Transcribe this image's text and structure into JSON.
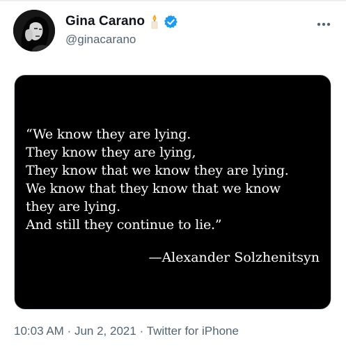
{
  "author": {
    "display_name": "Gina Carano",
    "handle": "@ginacarano",
    "avatar_icon": "profile-photo",
    "status_emoji": "candle-icon",
    "verified_badge": "verified-check-icon"
  },
  "more_menu_icon": "ellipsis-icon",
  "media": {
    "background": "#000000",
    "quote_lines": [
      "“We know they are lying.",
      "They know they are lying,",
      "They know that we know they are lying.",
      "We know that they know that we know",
      "they are lying.",
      "And still they continue to lie.”"
    ],
    "attribution": "—Alexander Solzhenitsyn"
  },
  "meta": {
    "time": "10:03 AM",
    "separator": "·",
    "date": "Jun 2, 2021",
    "source": "Twitter for iPhone"
  },
  "colors": {
    "text_primary": "#0f1419",
    "text_secondary": "#536471",
    "verified_blue": "#1d9bf0"
  }
}
